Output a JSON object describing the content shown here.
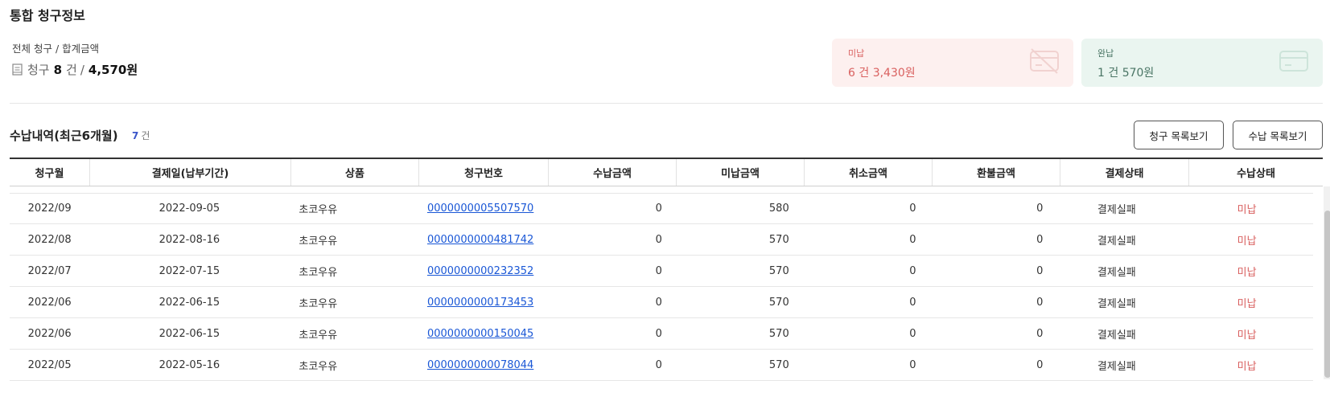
{
  "page": {
    "title": "통합 청구정보"
  },
  "summary": {
    "label": "전체 청구 / 합계금액",
    "icon": "receipt-icon",
    "word": "청구",
    "count": "8",
    "unit": "건",
    "slash": "/",
    "amount": "4,570원"
  },
  "stats": {
    "unpaid": {
      "label": "미납",
      "value": "6 건 3,430원",
      "icon": "card-off-icon",
      "color": "#d9605f",
      "bg": "#fdf0ef"
    },
    "paid": {
      "label": "완납",
      "value": "1 건 570원",
      "icon": "card-icon",
      "color": "#4a7565",
      "bg": "#eaf5f0"
    }
  },
  "history": {
    "title": "수납내역(최근6개월)",
    "count": "7",
    "count_unit": "건",
    "buttons": {
      "bill_list": "청구 목록보기",
      "payment_list": "수납 목록보기"
    }
  },
  "table": {
    "columns": [
      "청구월",
      "결제일(납부기간)",
      "상품",
      "청구번호",
      "수납금액",
      "미납금액",
      "취소금액",
      "환불금액",
      "결제상태",
      "수납상태"
    ],
    "rows": [
      [
        "2022/09",
        "2022-09-05",
        "초코우유",
        "0000000005507570",
        "0",
        "580",
        "0",
        "0",
        "결제실패",
        "미납"
      ],
      [
        "2022/08",
        "2022-08-16",
        "초코우유",
        "0000000000481742",
        "0",
        "570",
        "0",
        "0",
        "결제실패",
        "미납"
      ],
      [
        "2022/07",
        "2022-07-15",
        "초코우유",
        "0000000000232352",
        "0",
        "570",
        "0",
        "0",
        "결제실패",
        "미납"
      ],
      [
        "2022/06",
        "2022-06-15",
        "초코우유",
        "0000000000173453",
        "0",
        "570",
        "0",
        "0",
        "결제실패",
        "미납"
      ],
      [
        "2022/06",
        "2022-06-15",
        "초코우유",
        "0000000000150045",
        "0",
        "570",
        "0",
        "0",
        "결제실패",
        "미납"
      ],
      [
        "2022/05",
        "2022-05-16",
        "초코우유",
        "0000000000078044",
        "0",
        "570",
        "0",
        "0",
        "결제실패",
        "미납"
      ]
    ]
  }
}
